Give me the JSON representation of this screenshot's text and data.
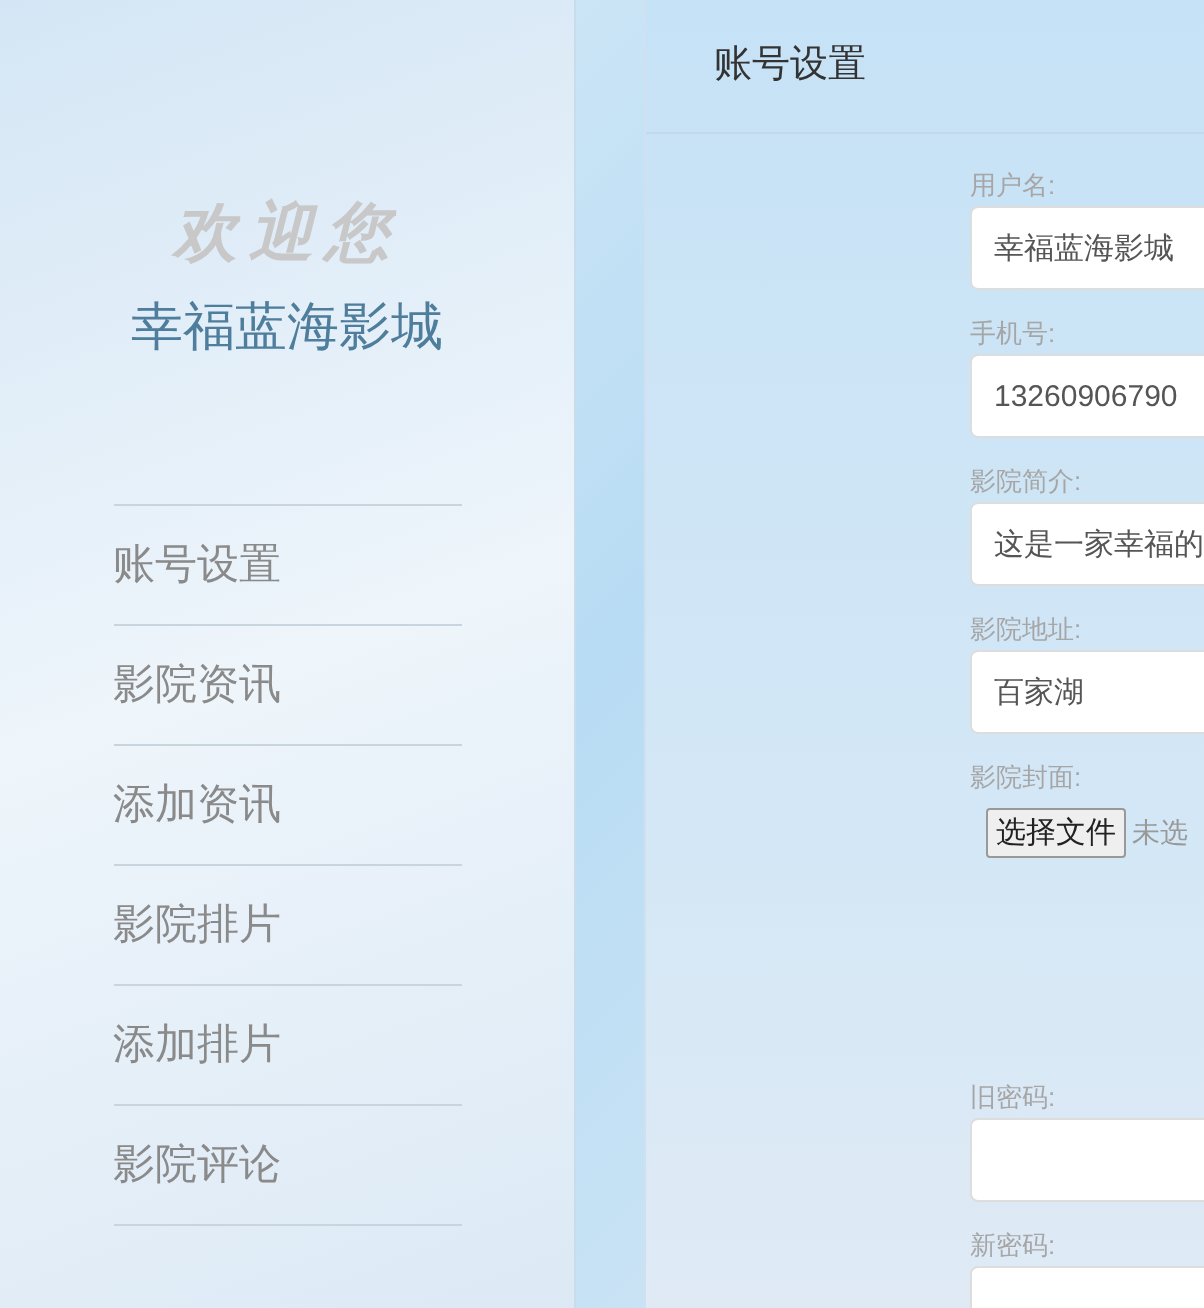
{
  "sidebar": {
    "welcome": "欢迎您",
    "cinema_name": "幸福蓝海影城",
    "items": [
      "账号设置",
      "影院资讯",
      "添加资讯",
      "影院排片",
      "添加排片",
      "影院评论"
    ]
  },
  "main": {
    "title": "账号设置",
    "fields": [
      {
        "kind": "text",
        "label": "用户名:",
        "value": "幸福蓝海影城"
      },
      {
        "kind": "text",
        "label": "手机号:",
        "value": "13260906790"
      },
      {
        "kind": "text",
        "label": "影院简介:",
        "value": "这是一家幸福的"
      },
      {
        "kind": "text",
        "label": "影院地址:",
        "value": "百家湖"
      },
      {
        "kind": "file",
        "label": "影院封面:",
        "button": "选择文件",
        "status": "未选"
      },
      {
        "kind": "password",
        "label": "旧密码:"
      },
      {
        "kind": "password",
        "label": "新密码:"
      }
    ]
  }
}
